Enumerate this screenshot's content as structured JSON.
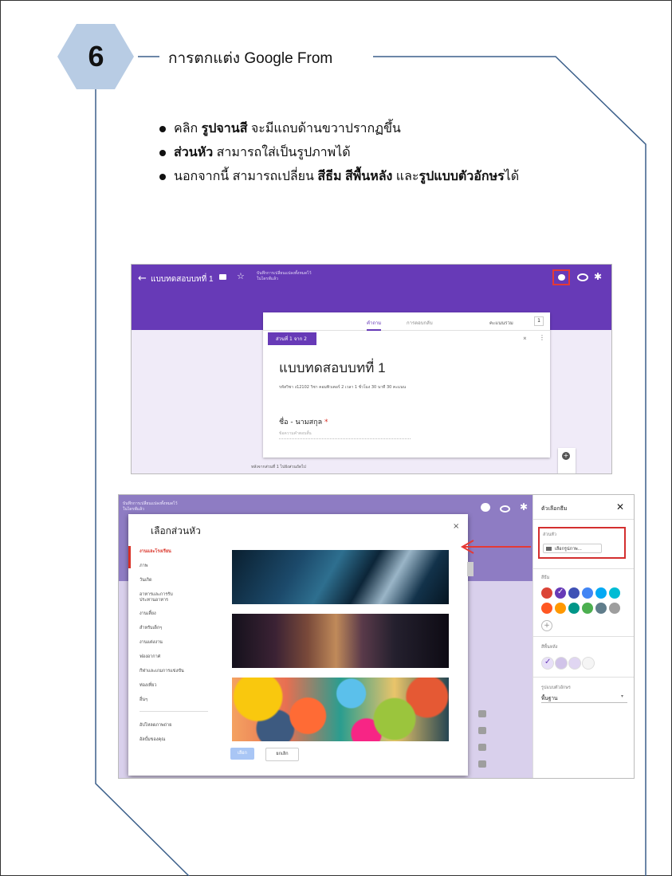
{
  "step": {
    "number": "6",
    "title": "การตกแต่ง Google From"
  },
  "bullets": [
    {
      "pre": "คลิก ",
      "bold": "รูปจานสี",
      "post": " จะมีแถบด้านขวาปรากฏขึ้น"
    },
    {
      "pre": "",
      "bold": "ส่วนหัว",
      "post": " สามารถใส่เป็นรูปภาพได้"
    },
    {
      "pre": "นอกจากนี้ สามารถเปลี่ยน ",
      "bold": "สีธีม สีพื้นหลัง",
      "mid": " และ",
      "bold2": "รูปแบบตัวอักษร",
      "post": "ได้"
    }
  ],
  "screenshot1": {
    "form_name": "แบบทดสอบบทที่ 1",
    "saved_note": "บันทึกการเปลี่ยนแปลงทั้งหมดไว้\nในไดรฟ์แล้ว",
    "tabs": {
      "questions": "คำถาม",
      "responses": "การตอบกลับ"
    },
    "score_label": "คะแนนรวม",
    "score_value": "1",
    "section_badge": "ส่วนที่ 1 จาก 2",
    "form_title": "แบบทดสอบบทที่ 1",
    "description": "รหัสวิชา ง12102  วิชา คอมพิวเตอร์ 2   เวลา 1 ชั่วโมง 30 นาที   30  คะแนน",
    "question_label": "ชื่อ - นามสกุล",
    "required_mark": "*",
    "answer_placeholder": "ข้อความคำตอบสั้น",
    "after_section": "หลังจากส่วนที่ 1    ไปยังส่วนถัดไป"
  },
  "screenshot2": {
    "saved_note": "บันทึกการเปลี่ยนแปลงทั้งหมดไว้\nในไดรฟ์แล้ว",
    "dialog_title": "เลือกส่วนหัว",
    "categories": [
      "งานและโรงเรียน",
      "ภาพ",
      "วันเกิด",
      "อาหารและการรับ\nประทานอาหาร",
      "งานเลี้ยง",
      "สำหรับเด็กๆ",
      "งานแต่งงาน",
      "ฟองอากาศ",
      "กีฬาและเกมการแข่งขัน",
      "ท่องเที่ยว",
      "อื่นๆ"
    ],
    "upload_items": [
      "อัปโหลดภาพถ่าย",
      "อัลบั้มของคุณ"
    ],
    "buttons": {
      "select": "เลือก",
      "cancel": "ยกเลิก"
    },
    "sidebar": {
      "title": "ตัวเลือกธีม",
      "header_label": "ส่วนหัว",
      "choose_image": "เลือกรูปภาพ...",
      "theme_label": "สีธีม",
      "bg_label": "สีพื้นหลัง",
      "font_label": "รูปแบบตัวอักษร",
      "font_value": "พื้นฐาน"
    },
    "theme_colors": [
      "#db4437",
      "#673ab7",
      "#3f51b5",
      "#4285f4",
      "#03a9f4",
      "#00bcd4",
      "#ff5722",
      "#ff9800",
      "#009688",
      "#4caf50",
      "#607d8b",
      "#9e9e9e"
    ],
    "bg_colors": [
      "#e8e0f8",
      "#d1c4e9",
      "#e0d6f2",
      "#f5f5f5"
    ]
  }
}
